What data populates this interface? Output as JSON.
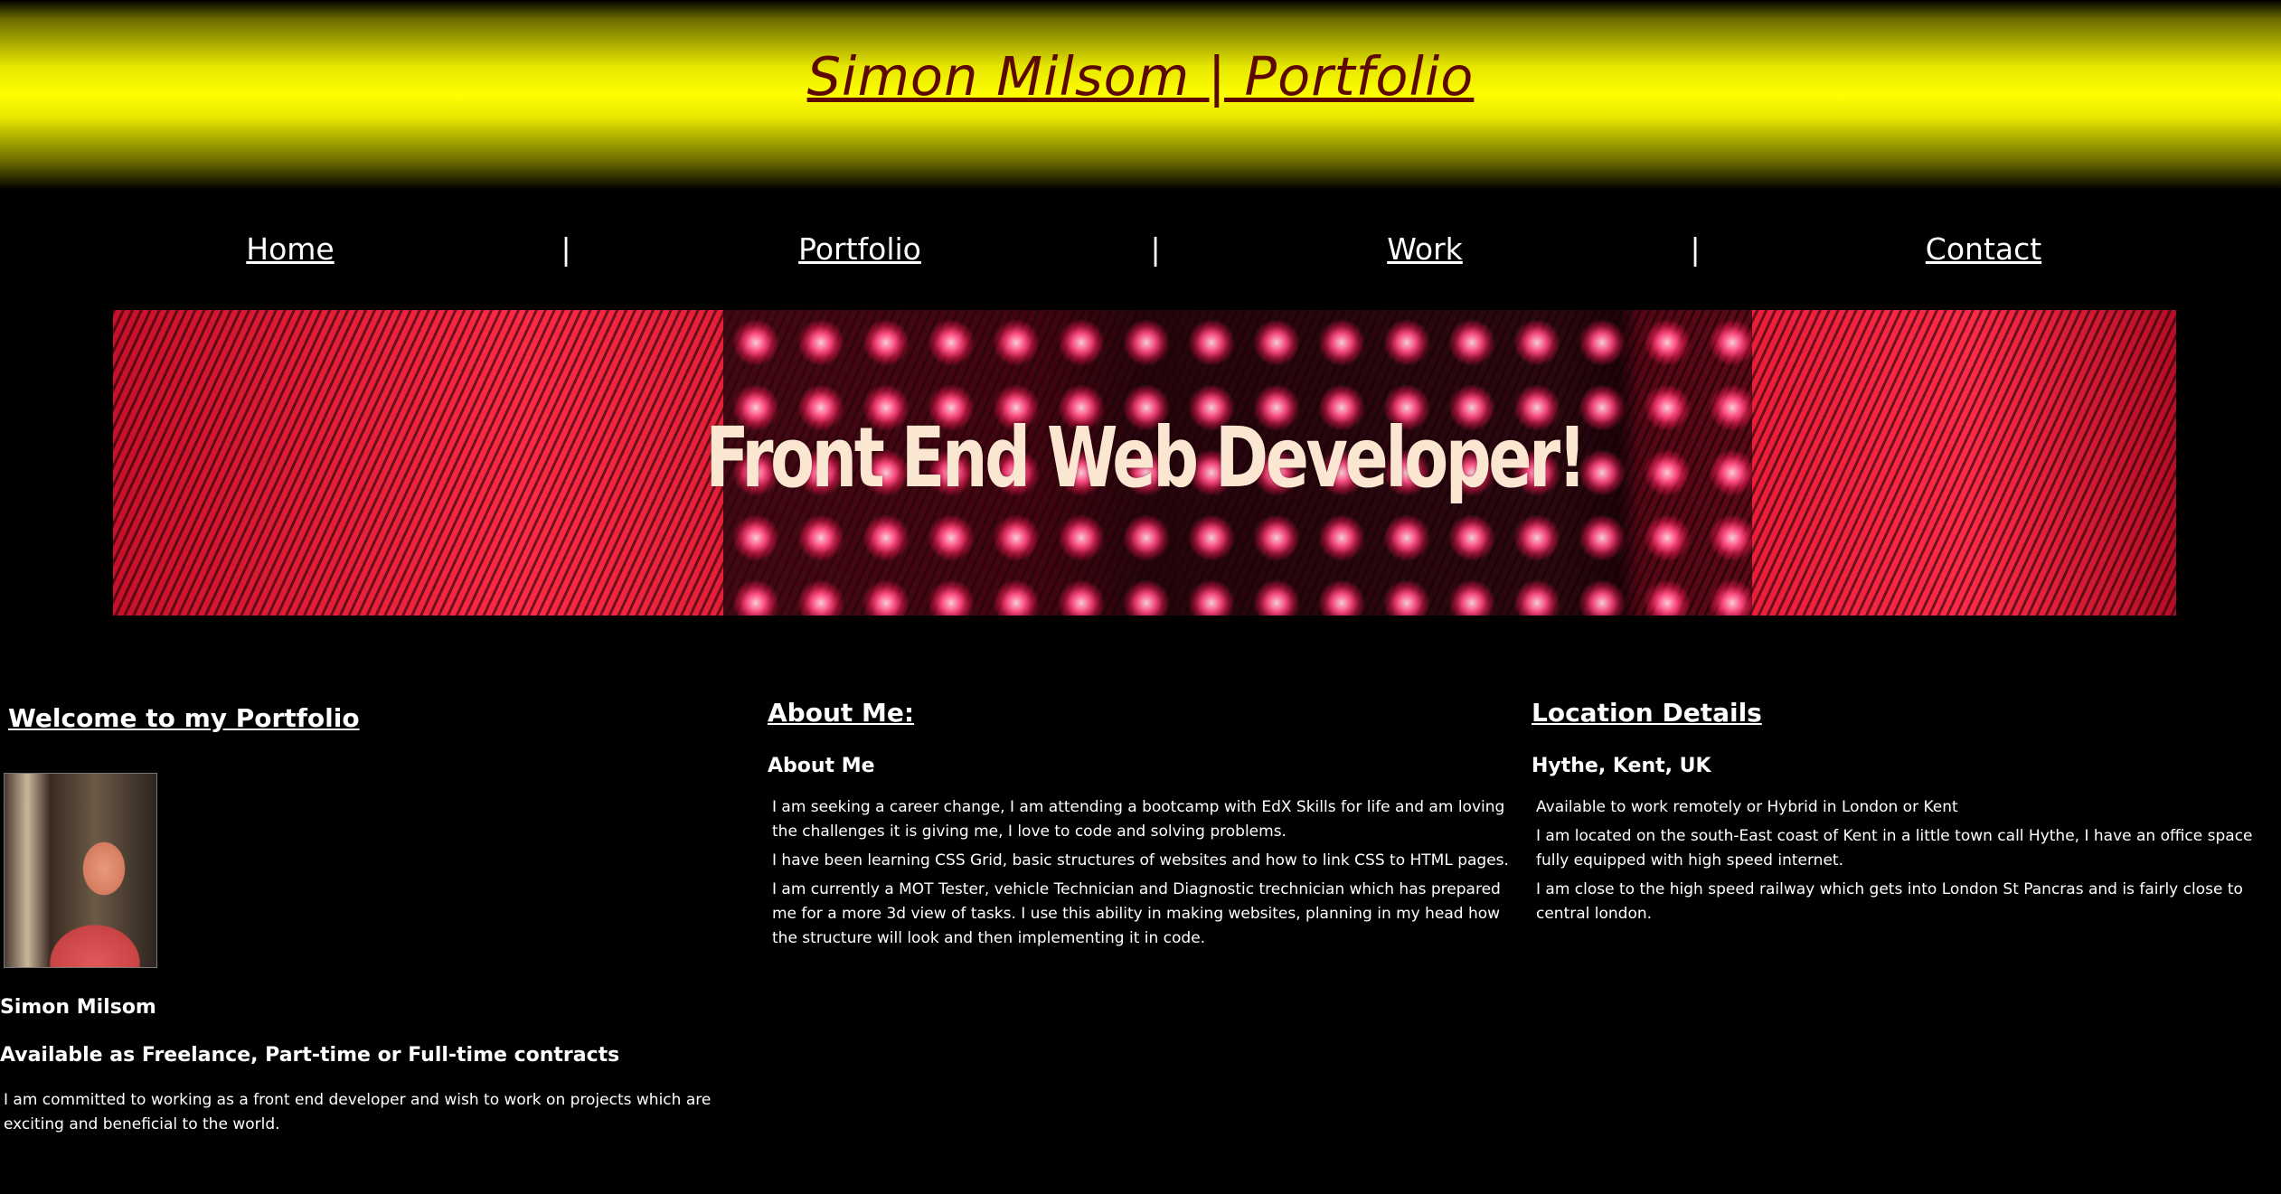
{
  "header": {
    "title": "Simon Milsom | Portfolio"
  },
  "nav": {
    "items": [
      {
        "label": "Home"
      },
      {
        "label": "Portfolio"
      },
      {
        "label": "Work"
      },
      {
        "label": "Contact"
      }
    ],
    "separator": "|"
  },
  "hero": {
    "text": "Front End Web Developer!"
  },
  "welcome": {
    "heading": "Welcome to my Portfolio",
    "name": "Simon Milsom",
    "availability": "Available as Freelance, Part-time or Full-time contracts",
    "statement": "I am committed to working as a front end developer and wish to work on projects which are exciting and beneficial to the world."
  },
  "about": {
    "heading": "About Me:",
    "subheading": "About Me",
    "paragraphs": [
      "I am seeking a career change, I am attending a bootcamp with EdX Skills for life and am loving the challenges it is giving me, I love to code and solving problems.",
      "I have been learning CSS Grid, basic structures of websites and how to link CSS to HTML pages.",
      "I am currently a MOT Tester, vehicle Technician and Diagnostic trechnician which has prepared me for a more 3d view of tasks. I use this ability in making websites, planning in my head how the structure will look and then implementing it in code."
    ]
  },
  "location": {
    "heading": "Location Details",
    "subheading": "Hythe, Kent, UK",
    "paragraphs": [
      "Available to work remotely or Hybrid in London or Kent",
      "I am located on the south-East coast of Kent in a little town call Hythe, I have an office space fully equipped with high speed internet.",
      "I am close to the high speed railway which gets into London St Pancras and is fairly close to central london."
    ]
  },
  "colors": {
    "header_yellow": "#ffff00",
    "title_color": "#5e0900",
    "background": "#000000"
  }
}
